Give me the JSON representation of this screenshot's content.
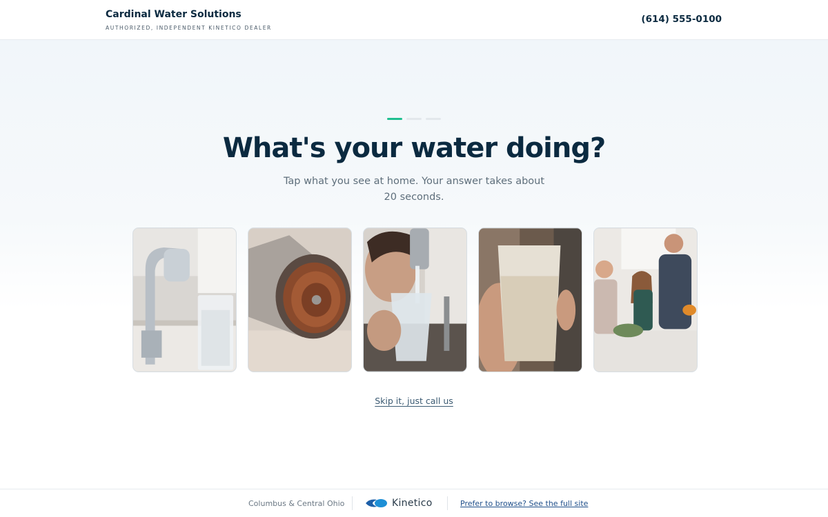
{
  "header": {
    "brand_name": "Cardinal Water Solutions",
    "brand_tagline": "AUTHORIZED, INDEPENDENT KINETICO DEALER",
    "phone": "(614) 555-0100"
  },
  "progress": {
    "current_step": 1,
    "total_steps": 3
  },
  "hero": {
    "title": "What's your water doing?",
    "subtitle": "Tap what you see at home. Your answer takes about 20 seconds."
  },
  "cards": [
    {
      "image": "faucet-with-cloudy-glass"
    },
    {
      "image": "rusty-faucet-aerator"
    },
    {
      "image": "woman-filling-glass-at-tap"
    },
    {
      "image": "hand-holding-cloudy-water-glass"
    },
    {
      "image": "family-in-kitchen"
    }
  ],
  "skip_link": "Skip it, just call us",
  "footer": {
    "region": "Columbus & Central Ohio",
    "partner_logo_text": "Kinetico",
    "browse_link": "Prefer to browse? See the full site"
  },
  "colors": {
    "navy": "#0b2a40",
    "accent_green": "#1fbf8f",
    "kinetico_blue": "#1d8fd6"
  }
}
